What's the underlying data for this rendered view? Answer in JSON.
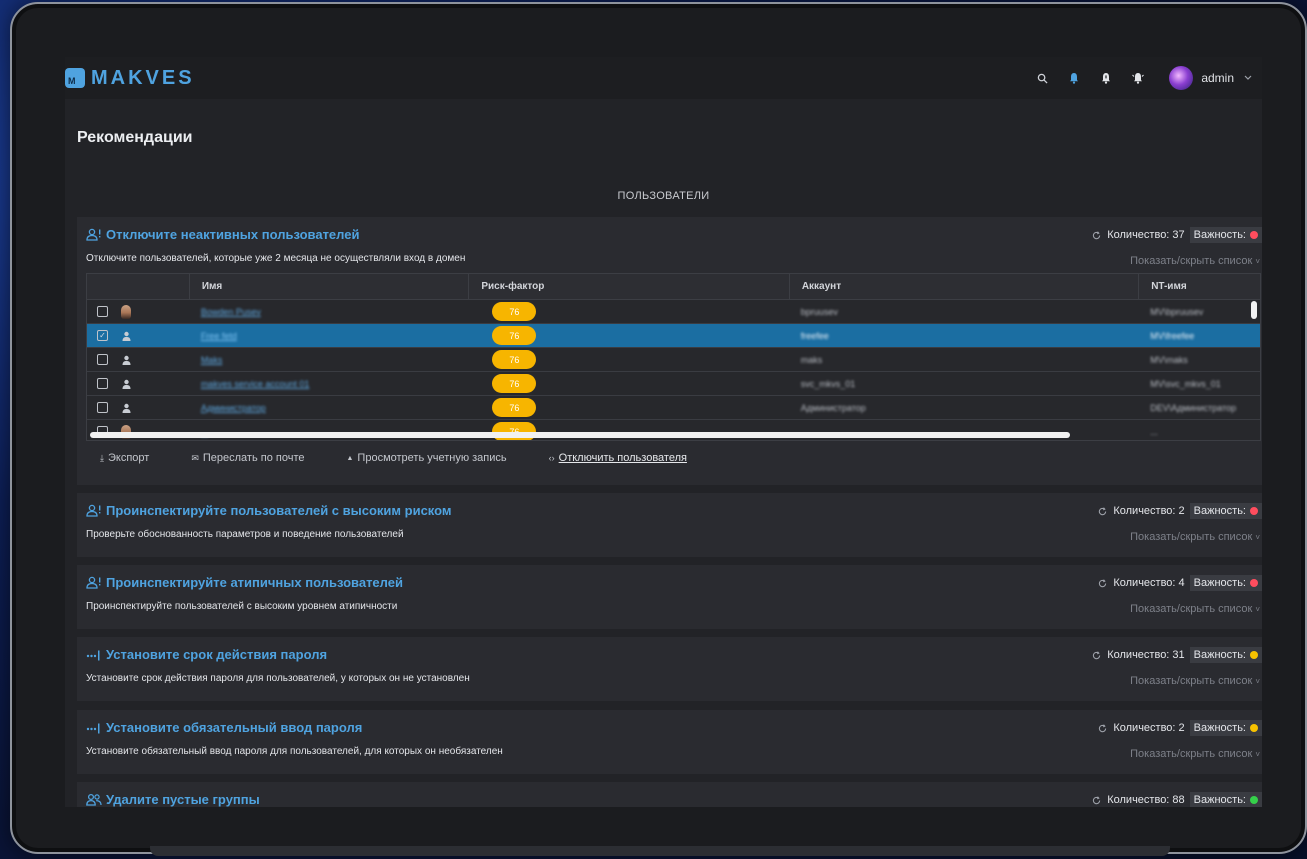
{
  "app": {
    "logo_letter": "M",
    "logo_text": "MAKVES",
    "accent": "#4fa3e0"
  },
  "header": {
    "user": "admin",
    "icons": [
      "search-icon",
      "bell-icon",
      "bell-alert-icon",
      "bell-ring-icon",
      "chevron-down-icon"
    ]
  },
  "page": {
    "title": "Рекомендации",
    "section": "ПОЛЬЗОВАТЕЛИ"
  },
  "cards": [
    {
      "title": "Отключите неактивных пользователей",
      "description": "Отключите пользователей, которые уже 2 месяца не осуществляли вход в домен",
      "count_label": "Количество: 37",
      "importance_label": "Важность:",
      "importance_color": "#ff4d5e",
      "toggle": "Показать/скрыть список",
      "icon": "user-alert-icon"
    },
    {
      "title": "Проинспектируйте пользователей с высоким риском",
      "description": "Проверьте обоснованность параметров и поведение пользователей",
      "count_label": "Количество: 2",
      "importance_label": "Важность:",
      "importance_color": "#ff4d5e",
      "toggle": "Показать/скрыть список",
      "icon": "user-alert-icon"
    },
    {
      "title": "Проинспектируйте атипичных пользователей",
      "description": "Проинспектируйте пользователей с высоким уровнем атипичности",
      "count_label": "Количество: 4",
      "importance_label": "Важность:",
      "importance_color": "#ff4d5e",
      "toggle": "Показать/скрыть список",
      "icon": "user-alert-icon"
    },
    {
      "title": "Установите срок действия пароля",
      "description": "Установите срок действия пароля для пользователей, у которых он не установлен",
      "count_label": "Количество: 31",
      "importance_label": "Важность:",
      "importance_color": "#f7c200",
      "toggle": "Показать/скрыть список",
      "icon": "password-icon"
    },
    {
      "title": "Установите обязательный ввод пароля",
      "description": "Установите обязательный ввод пароля для пользователей, для которых он необязателен",
      "count_label": "Количество: 2",
      "importance_label": "Важность:",
      "importance_color": "#f7c200",
      "toggle": "Показать/скрыть список",
      "icon": "password-icon"
    },
    {
      "title": "Удалите пустые группы",
      "description": "",
      "count_label": "Количество: 88",
      "importance_label": "Важность:",
      "importance_color": "#35d04a",
      "toggle": "",
      "icon": "group-icon"
    }
  ],
  "table": {
    "columns": [
      "",
      "Имя",
      "Риск-фактор",
      "Аккаунт",
      "NT-имя"
    ],
    "rows": [
      {
        "checked": false,
        "photo": true,
        "name": "Bowden Pusev",
        "risk": "76",
        "account": "bpruusev",
        "nt": "MV\\bpruusev"
      },
      {
        "checked": true,
        "photo": false,
        "name": "Free fetd",
        "risk": "76",
        "account": "freefee",
        "nt": "MV\\freefee"
      },
      {
        "checked": false,
        "photo": false,
        "name": "Maks",
        "risk": "76",
        "account": "maks",
        "nt": "MV\\maks"
      },
      {
        "checked": false,
        "photo": false,
        "name": "makves service account 01",
        "risk": "76",
        "account": "svc_mkvs_01",
        "nt": "MV\\svc_mkvs_01"
      },
      {
        "checked": false,
        "photo": false,
        "name": "Администратор",
        "risk": "76",
        "account": "Администратор",
        "nt": "DEV\\Администратор"
      },
      {
        "checked": false,
        "photo": true,
        "name": "...",
        "risk": "76",
        "account": "...",
        "nt": "..."
      }
    ]
  },
  "actions": [
    {
      "label": "Экспорт",
      "icon": "download-icon",
      "glyph": "⤓",
      "underline": false
    },
    {
      "label": "Переслать по почте",
      "icon": "mail-icon",
      "glyph": "✉",
      "underline": false
    },
    {
      "label": "Просмотреть учетную запись",
      "icon": "user-icon",
      "glyph": "▲",
      "underline": false
    },
    {
      "label": "Отключить пользователя",
      "icon": "code-icon",
      "glyph": "‹›",
      "underline": true
    }
  ]
}
